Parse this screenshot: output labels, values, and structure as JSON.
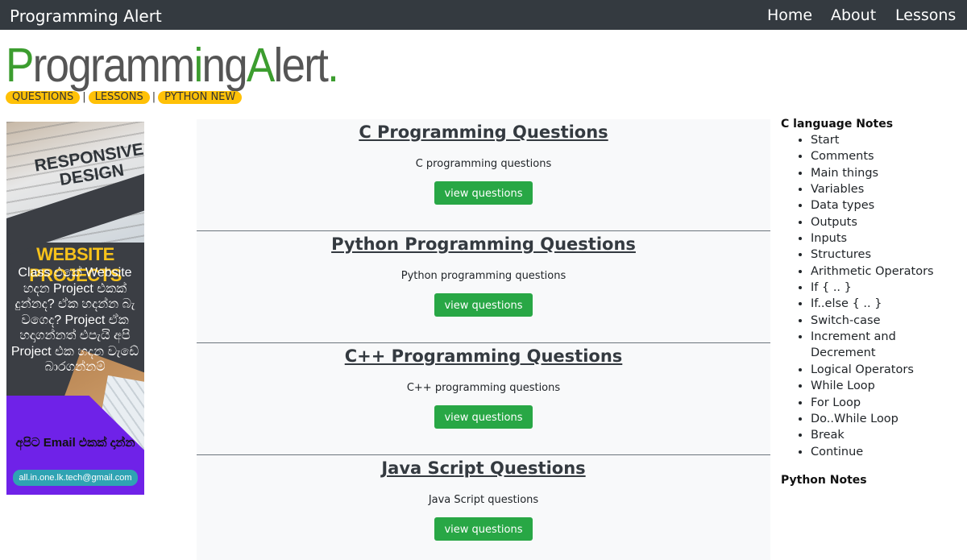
{
  "navbar": {
    "brand": "Programming Alert",
    "links": [
      "Home",
      "About",
      "Lessons"
    ]
  },
  "logo": {
    "part1": "Programm",
    "part2": "i",
    "part3": "ng",
    "part4": "A",
    "part5": "lert",
    "dot": ".",
    "text": "ProgrammingAlert."
  },
  "tags": [
    "QUESTIONS",
    "LESSONS",
    "PYTHON NEW"
  ],
  "tag_separator": "|",
  "ad": {
    "heading1": "RESPONSIVE",
    "heading2": "DESIGN",
    "title": "WEBSITE PROJECTS",
    "body": "Class එකේ Website හදන Project එකක් දුන්නද? ඒක හදන්න බැ වගෙද? Project ඒක හදාගන්නත් එපැයි අපි Project එක හදන වැඩේ බාරගන්නම්",
    "email_prompt": "අපිට Email එකක් දාන්න",
    "email": "all.in.one.lk.tech@gmail.com"
  },
  "cards": [
    {
      "title": "C Programming Questions",
      "desc": "C programming questions",
      "button": "view questions"
    },
    {
      "title": "Python Programming Questions",
      "desc": "Python programming questions",
      "button": "view questions"
    },
    {
      "title": "C++ Programming Questions",
      "desc": "C++ programming questions",
      "button": "view questions"
    },
    {
      "title": "Java Script Questions",
      "desc": "Java Script questions",
      "button": "view questions"
    }
  ],
  "sidebar": {
    "heading": "C language Notes",
    "items": [
      "Start",
      "Comments",
      "Main things",
      "Variables",
      "Data types",
      "Outputs",
      "Inputs",
      "Structures",
      "Arithmetic Operators",
      "If { .. }",
      "If..else { .. }",
      "Switch-case",
      "Increment and Decrement",
      "Logical Operators",
      "While Loop",
      "For Loop",
      "Do..While Loop",
      "Break",
      "Continue"
    ],
    "heading2": "Python Notes"
  },
  "colors": {
    "navbar": "#343a40",
    "tag": "#ffc107",
    "button": "#28a745",
    "logo_green": "#3c9d2f",
    "logo_gray": "#555555"
  }
}
